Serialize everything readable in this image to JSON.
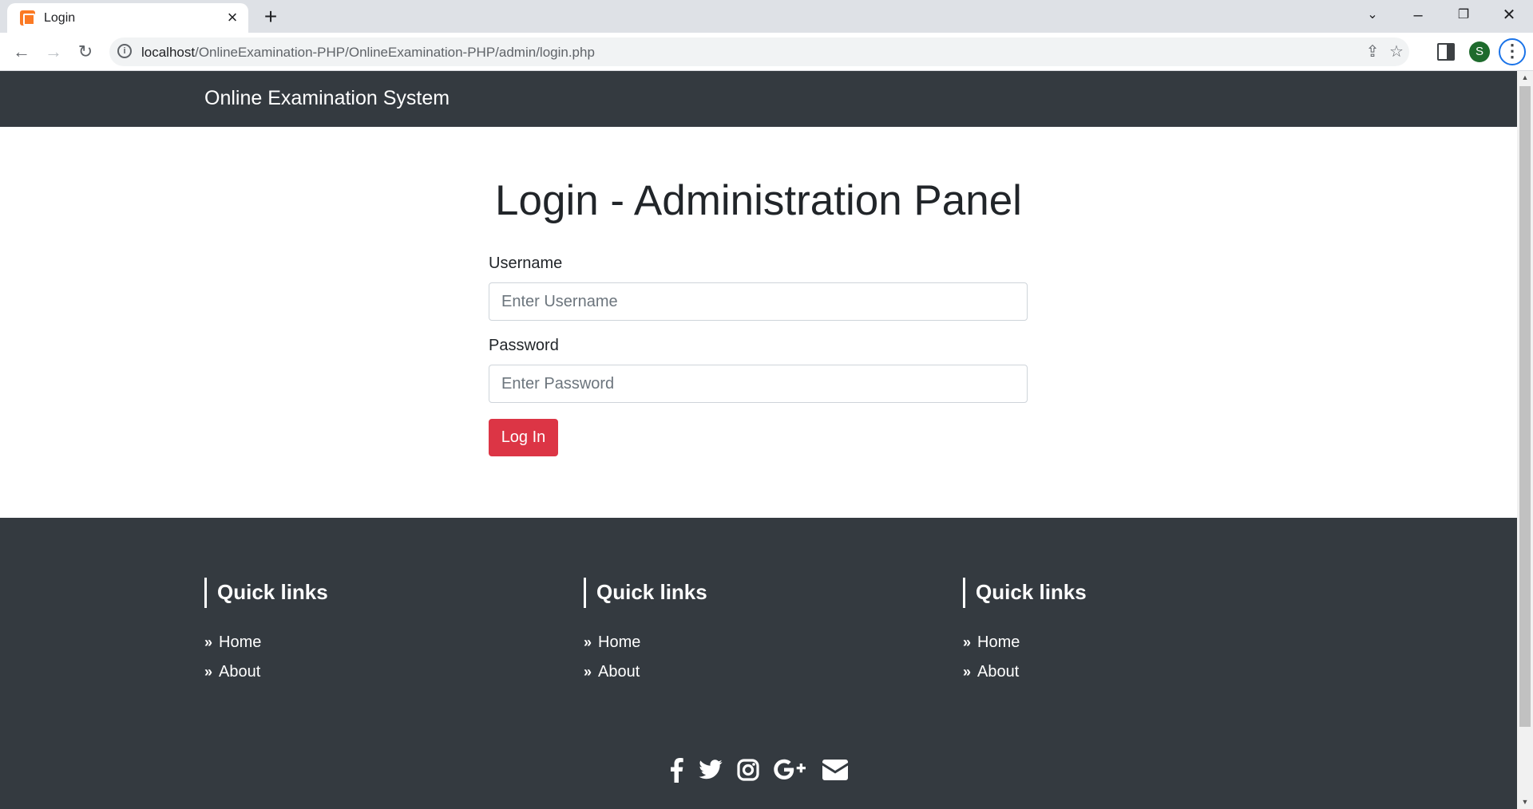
{
  "browser": {
    "tab_title": "Login",
    "address": {
      "host": "localhost",
      "path": "/OnlineExamination-PHP/OnlineExamination-PHP/admin/login.php"
    },
    "profile_initial": "S"
  },
  "navbar": {
    "brand": "Online Examination System"
  },
  "login": {
    "heading": "Login - Administration Panel",
    "username_label": "Username",
    "username_placeholder": "Enter Username",
    "password_label": "Password",
    "password_placeholder": "Enter Password",
    "submit_label": "Log In"
  },
  "footer": {
    "columns": [
      {
        "title": "Quick links",
        "links": [
          "Home",
          "About"
        ]
      },
      {
        "title": "Quick links",
        "links": [
          "Home",
          "About"
        ]
      },
      {
        "title": "Quick links",
        "links": [
          "Home",
          "About"
        ]
      }
    ],
    "socials": [
      "facebook-icon",
      "twitter-icon",
      "instagram-icon",
      "google-plus-icon",
      "envelope-icon"
    ]
  },
  "colors": {
    "navbar_bg": "#343a40",
    "button_danger": "#dc3545",
    "text_dark": "#212529"
  }
}
